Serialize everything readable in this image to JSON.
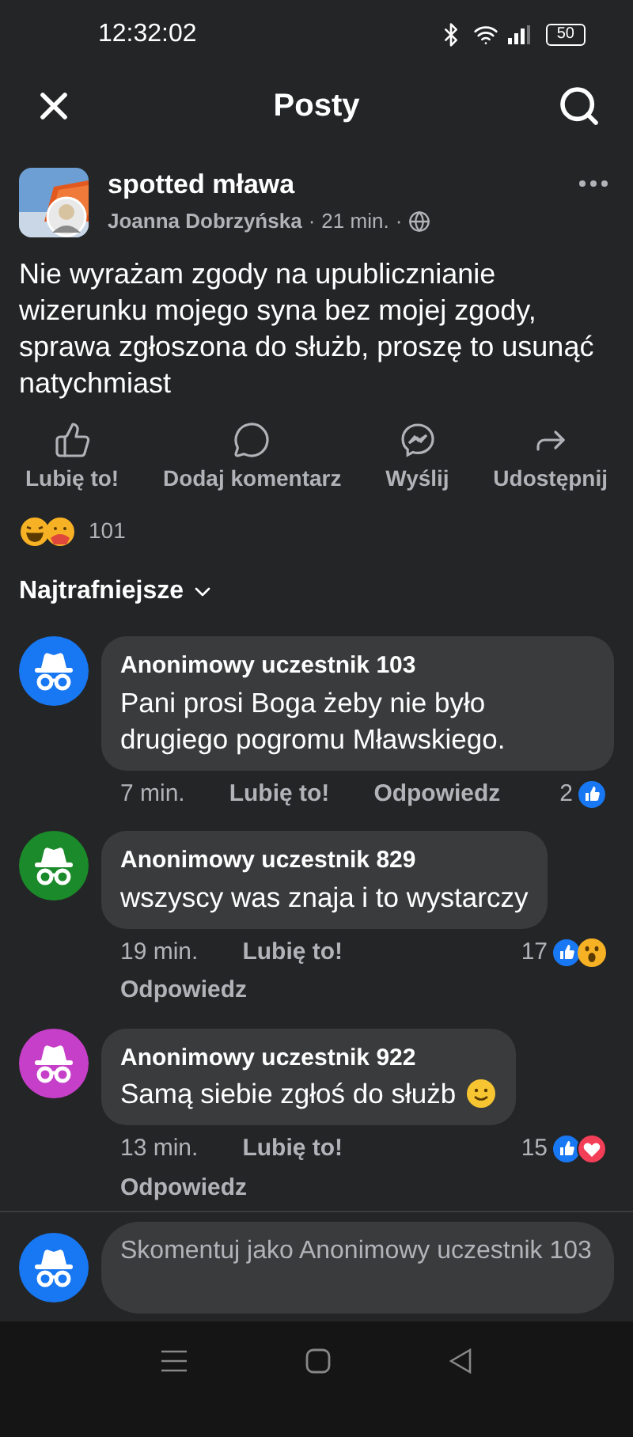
{
  "status_bar": {
    "time": "12:32:02",
    "battery": "50"
  },
  "header": {
    "title": "Posty"
  },
  "post": {
    "group": "spotted mława",
    "author": "Joanna Dobrzyńska",
    "time": "21 min.",
    "separator": "·",
    "text": "Nie wyrażam zgody na upublicznianie wizerunku mojego syna bez mojej zgody, sprawa zgłoszona do służb, proszę to usunąć natychmiast",
    "actions": [
      {
        "kind": "like",
        "label": "Lubię to!"
      },
      {
        "kind": "comment",
        "label": "Dodaj komentarz"
      },
      {
        "kind": "send",
        "label": "Wyślij"
      },
      {
        "kind": "share",
        "label": "Udostępnij"
      }
    ],
    "reactions": [
      {
        "kind": "haha"
      },
      {
        "kind": "care"
      }
    ],
    "reaction_count": "101"
  },
  "sort": {
    "label": "Najtrafniejsze"
  },
  "comments": [
    {
      "author": "Anonimowy uczestnik 103",
      "text": "Pani prosi Boga żeby nie było drugiego pogromu Mławskiego.",
      "emoji": false,
      "color": "#1877f2",
      "time": "7 min.",
      "like": "Lubię to!",
      "reply": "Odpowiedz",
      "count": "2",
      "reactions": [
        {
          "kind": "like"
        }
      ]
    },
    {
      "author": "Anonimowy uczestnik 829",
      "text": "wszyscy was znaja i to wystarczy",
      "emoji": false,
      "color": "#1a8a2a",
      "time": "19 min.",
      "like": "Lubię to!",
      "reply": "Odpowiedz",
      "count": "17",
      "reactions": [
        {
          "kind": "like"
        },
        {
          "kind": "wow"
        }
      ]
    },
    {
      "author": "Anonimowy uczestnik 922",
      "text": "Samą siebie zgłoś do służb",
      "emoji": true,
      "color": "#c63fc9",
      "time": "13 min.",
      "like": "Lubię to!",
      "reply": "Odpowiedz",
      "count": "15",
      "reactions": [
        {
          "kind": "like"
        },
        {
          "kind": "love"
        }
      ]
    }
  ],
  "composer": {
    "placeholder": "Skomentuj jako Anonimowy uczestnik 103",
    "color": "#1877f2"
  }
}
